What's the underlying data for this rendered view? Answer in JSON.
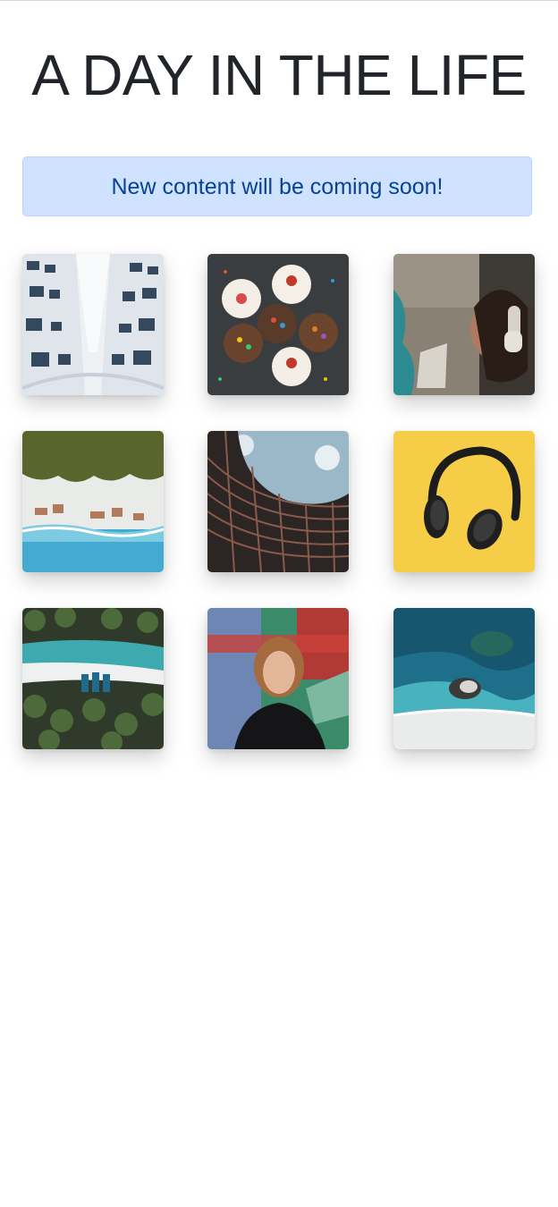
{
  "header": {
    "title": "A DAY IN THE LIFE"
  },
  "alert": {
    "message": "New content will be coming soon!",
    "background": "#cfe2ff",
    "text_color": "#084298"
  },
  "gallery": {
    "items": [
      {
        "name": "photo-building-looking-up"
      },
      {
        "name": "photo-cupcakes"
      },
      {
        "name": "photo-woman-headphones-graffiti"
      },
      {
        "name": "photo-aerial-beach-trees"
      },
      {
        "name": "photo-curved-building"
      },
      {
        "name": "photo-headphones-yellow"
      },
      {
        "name": "photo-aerial-palm-beach"
      },
      {
        "name": "photo-boy-graffiti-wall"
      },
      {
        "name": "photo-aerial-ocean-rocks"
      }
    ]
  }
}
